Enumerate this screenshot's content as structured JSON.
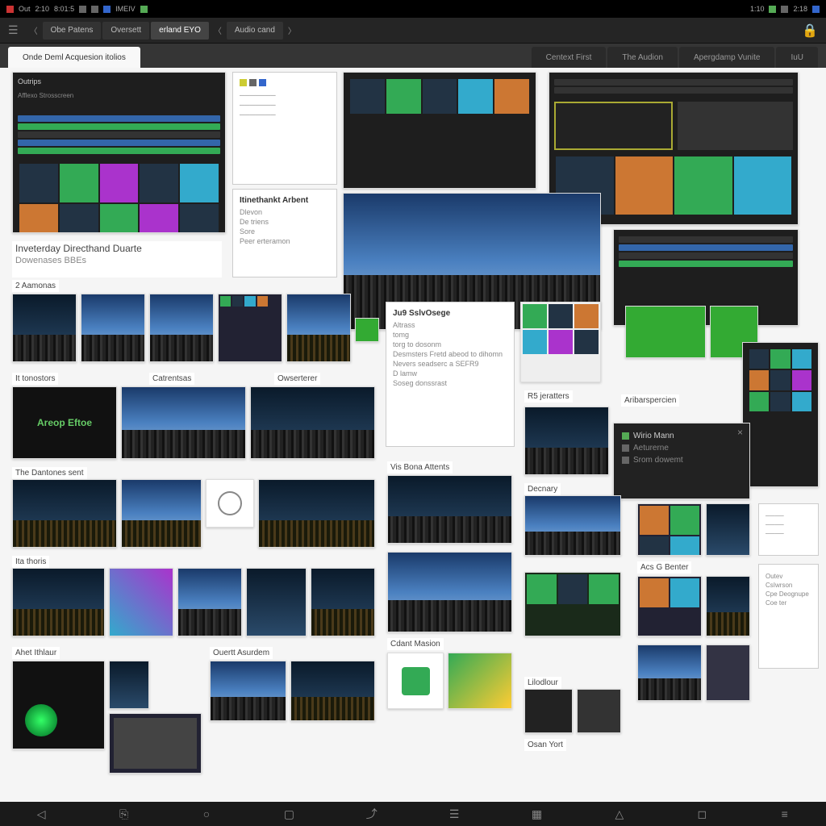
{
  "statusbar": {
    "left_items": [
      "Out",
      "2:10",
      "8:01:5",
      "IMEIV"
    ],
    "right_items": [
      "1:10",
      "2:18"
    ]
  },
  "toolbar": {
    "items": [
      {
        "label": "Obe Patens",
        "active": false
      },
      {
        "label": "Oversett",
        "active": false
      },
      {
        "label": "erland EYO",
        "active": true
      },
      {
        "label": "Audio cand",
        "active": false
      }
    ]
  },
  "tabs": [
    {
      "label": "Onde Deml Acquesion itolios",
      "active": true
    },
    {
      "label": "Centext First",
      "active": false
    },
    {
      "label": "The Audion",
      "active": false
    },
    {
      "label": "Apergdamp Vunite",
      "active": false
    },
    {
      "label": "IuU",
      "active": false
    }
  ],
  "section_header": {
    "title": "Inveterday Directhand Duarte",
    "subtitle": "Dowenases BBEs"
  },
  "side_panels": {
    "top_left": {
      "heading": "Outrips",
      "sub": "Afflexo Strosscreen"
    },
    "top_mid": {
      "heading": "Itinethankt Arbent",
      "items": [
        "Dlevon",
        "De triens",
        "Sore",
        "Peer erteramon"
      ]
    },
    "info_box": {
      "heading": "Ju9 SslvOsege",
      "items": [
        "Altrass",
        "tomg",
        "torg to dosonm",
        "Desmsters Fretd abeod to dihomn",
        "Nevers seadserc a SEFR9",
        "D lamw",
        "Soseg donssrast"
      ]
    },
    "right_box": {
      "items": [
        "Outev",
        "CsIwrson",
        "Cpe Deognupe",
        "Coe ter"
      ]
    }
  },
  "captions": {
    "c1": "It tonostors",
    "c2": "Catrentsas",
    "c3": "Owserterer",
    "c4": "The Dantones sent",
    "c5": "2 Aamonas",
    "c6": "Ita thoris",
    "c7": "Areop Eftoe",
    "c8": "Decnary",
    "c9": "Acs G Benter",
    "c10": "Cdant Masion",
    "c11": "Ouertt Asurdem",
    "c12": "Vis Bona Attents",
    "c13": "R5 jeratters",
    "c14": "Ahet Ithlaur",
    "c15": "Aribarspercien",
    "c16": "Lilodlour",
    "c17": "Osan Yort"
  },
  "overlay_card": {
    "title": "Wirio Mann",
    "line1": "Aeturerne",
    "line2": "Srom dowemt"
  },
  "nav_icons": [
    "back",
    "tab",
    "home",
    "apps",
    "share",
    "menu",
    "grid",
    "up",
    "window",
    "list"
  ]
}
